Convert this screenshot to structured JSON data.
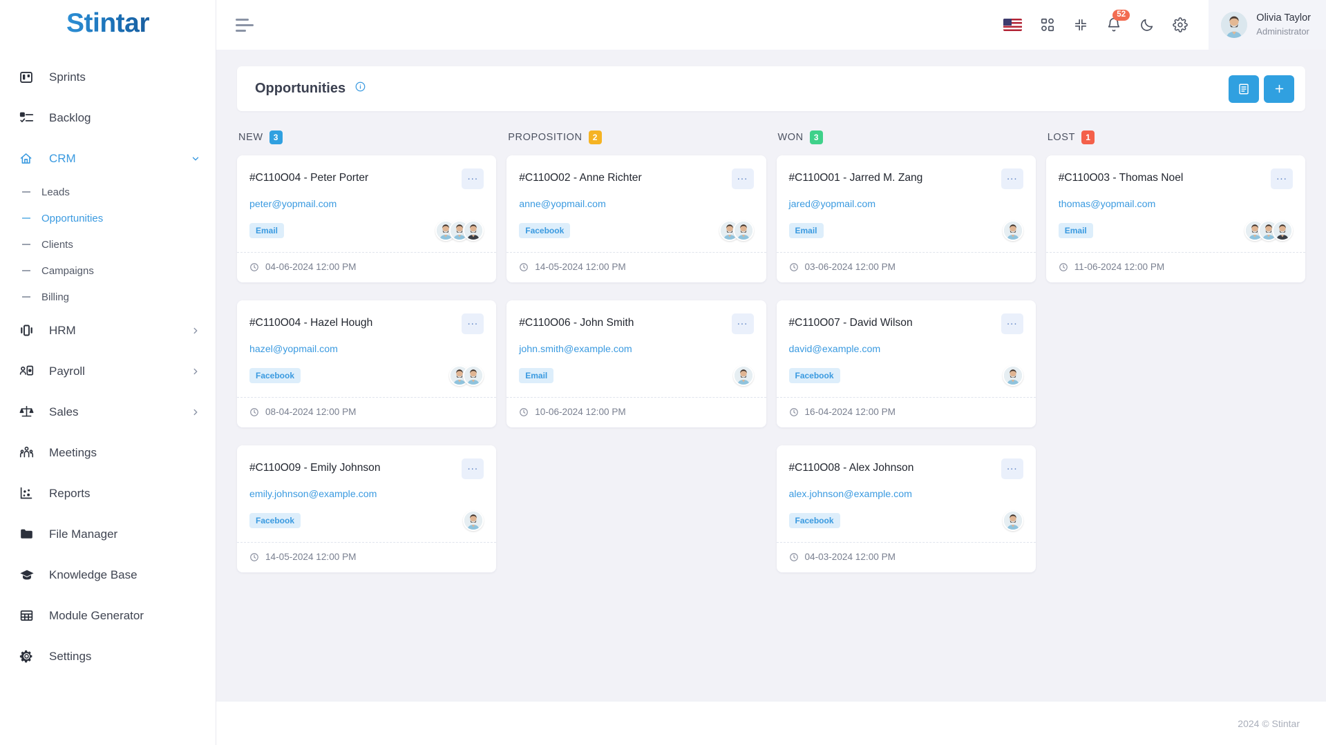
{
  "brand": {
    "name": "Stintar"
  },
  "sidebar": {
    "items": [
      {
        "label": "Sprints",
        "icon": "board-icon",
        "type": "item",
        "active": false,
        "chevron": ""
      },
      {
        "label": "Backlog",
        "icon": "checklist-icon",
        "type": "item",
        "active": false,
        "chevron": ""
      },
      {
        "label": "CRM",
        "icon": "crm-icon",
        "type": "item",
        "active": true,
        "chevron": "down"
      },
      {
        "label": "Leads",
        "icon": "dash-icon",
        "type": "sub",
        "active": false
      },
      {
        "label": "Opportunities",
        "icon": "dash-icon",
        "type": "sub",
        "active": true
      },
      {
        "label": "Clients",
        "icon": "dash-icon",
        "type": "sub",
        "active": false
      },
      {
        "label": "Campaigns",
        "icon": "dash-icon",
        "type": "sub",
        "active": false
      },
      {
        "label": "Billing",
        "icon": "dash-icon",
        "type": "sub",
        "active": false
      },
      {
        "label": "HRM",
        "icon": "hrm-icon",
        "type": "item",
        "active": false,
        "chevron": "right"
      },
      {
        "label": "Payroll",
        "icon": "payroll-icon",
        "type": "item",
        "active": false,
        "chevron": "right"
      },
      {
        "label": "Sales",
        "icon": "scales-icon",
        "type": "item",
        "active": false,
        "chevron": "right"
      },
      {
        "label": "Meetings",
        "icon": "people-icon",
        "type": "item",
        "active": false,
        "chevron": ""
      },
      {
        "label": "Reports",
        "icon": "scatter-chart-icon",
        "type": "item",
        "active": false,
        "chevron": ""
      },
      {
        "label": "File Manager",
        "icon": "folder-icon",
        "type": "item",
        "active": false,
        "chevron": ""
      },
      {
        "label": "Knowledge Base",
        "icon": "graduation-cap-icon",
        "type": "item",
        "active": false,
        "chevron": ""
      },
      {
        "label": "Module Generator",
        "icon": "grid-table-icon",
        "type": "item",
        "active": false,
        "chevron": ""
      },
      {
        "label": "Settings",
        "icon": "gear-icon",
        "type": "item",
        "active": false,
        "chevron": ""
      }
    ]
  },
  "topbar": {
    "menu_toggle": "hamburger-icon",
    "icons": [
      {
        "name": "language-flag-us",
        "glyph": "flag"
      },
      {
        "name": "apps-grid-icon",
        "glyph": "apps"
      },
      {
        "name": "fullscreen-exit-icon",
        "glyph": "collapse"
      },
      {
        "name": "notification-bell-icon",
        "glyph": "bell",
        "badge": "52"
      },
      {
        "name": "dark-mode-icon",
        "glyph": "moon"
      },
      {
        "name": "settings-gear-icon",
        "glyph": "gear"
      }
    ],
    "notification_count": "52",
    "profile": {
      "name": "Olivia Taylor",
      "role": "Administrator"
    }
  },
  "page": {
    "title": "Opportunities",
    "info_icon": "info-circle-icon",
    "actions": [
      {
        "name": "list-view-button",
        "glyph": "list"
      },
      {
        "name": "add-opportunity-button",
        "glyph": "plus"
      }
    ]
  },
  "board": {
    "columns": [
      {
        "name": "NEW",
        "count": "3",
        "color": "#30a0e0",
        "cards": [
          {
            "title": "#C110O04 - Peter Porter",
            "email": "peter@yopmail.com",
            "tag": "Email",
            "date": "04-06-2024 12:00 PM",
            "avatars": 3,
            "menu": "..."
          },
          {
            "title": "#C110O04 - Hazel Hough",
            "email": "hazel@yopmail.com",
            "tag": "Facebook",
            "date": "08-04-2024 12:00 PM",
            "avatars": 2,
            "menu": "..."
          },
          {
            "title": "#C110O09 - Emily Johnson",
            "email": "emily.johnson@example.com",
            "tag": "Facebook",
            "date": "14-05-2024 12:00 PM",
            "avatars": 1,
            "menu": "..."
          }
        ]
      },
      {
        "name": "PROPOSITION",
        "count": "2",
        "color": "#f5b323",
        "cards": [
          {
            "title": "#C110O02 - Anne Richter",
            "email": "anne@yopmail.com",
            "tag": "Facebook",
            "date": "14-05-2024 12:00 PM",
            "avatars": 2,
            "menu": "..."
          },
          {
            "title": "#C110O06 - John Smith",
            "email": "john.smith@example.com",
            "tag": "Email",
            "date": "10-06-2024 12:00 PM",
            "avatars": 1,
            "menu": "..."
          }
        ]
      },
      {
        "name": "WON",
        "count": "3",
        "color": "#3fd18a",
        "cards": [
          {
            "title": "#C110O01 - Jarred M. Zang",
            "email": "jared@yopmail.com",
            "tag": "Email",
            "date": "03-06-2024 12:00 PM",
            "avatars": 1,
            "menu": "..."
          },
          {
            "title": "#C110O07 - David Wilson",
            "email": "david@example.com",
            "tag": "Facebook",
            "date": "16-04-2024 12:00 PM",
            "avatars": 1,
            "menu": "..."
          },
          {
            "title": "#C110O08 - Alex Johnson",
            "email": "alex.johnson@example.com",
            "tag": "Facebook",
            "date": "04-03-2024 12:00 PM",
            "avatars": 1,
            "menu": "..."
          }
        ]
      },
      {
        "name": "LOST",
        "count": "1",
        "color": "#f4604a",
        "cards": [
          {
            "title": "#C110O03 - Thomas Noel",
            "email": "thomas@yopmail.com",
            "tag": "Email",
            "date": "11-06-2024 12:00 PM",
            "avatars": 3,
            "menu": "..."
          }
        ]
      }
    ]
  },
  "footer": {
    "copyright": "2024 © Stintar"
  }
}
